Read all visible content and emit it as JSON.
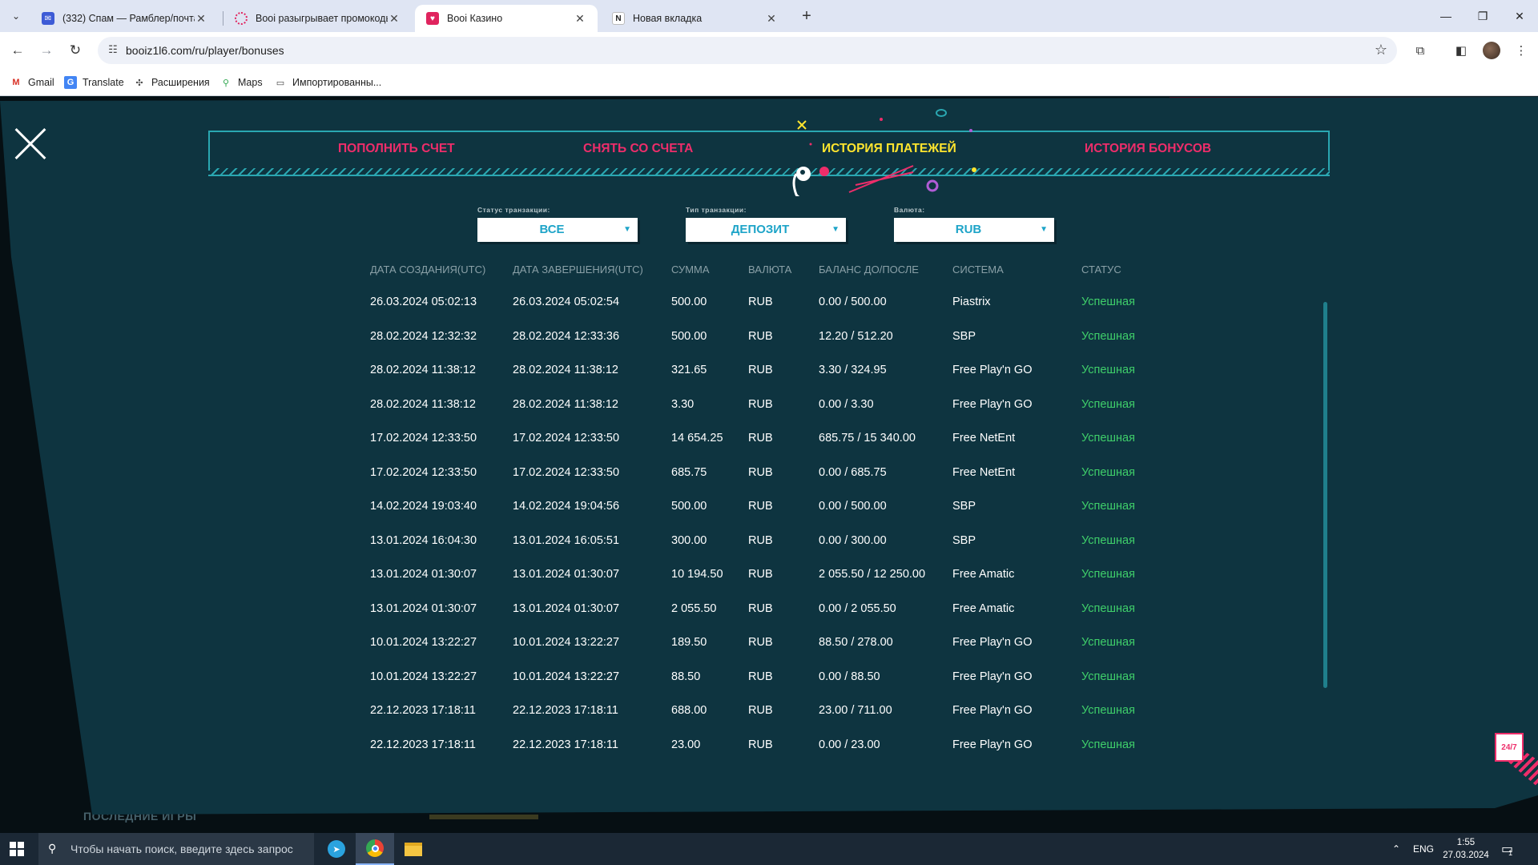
{
  "browser": {
    "tabs": [
      {
        "label": "(332) Спам — Рамблер/почта",
        "close": "✕",
        "active": false
      },
      {
        "label": "Booi разыгрывает промокоды",
        "close": "✕",
        "active": false
      },
      {
        "label": "Booi Казино",
        "close": "✕",
        "active": true
      },
      {
        "label": "Новая вкладка",
        "close": "✕",
        "active": false
      }
    ],
    "new_tab": "+",
    "url": "booiz1l6.com/ru/player/bonuses",
    "bookmarks": [
      "Gmail",
      "Translate",
      "Расширения",
      "Maps",
      "Импортированны..."
    ],
    "colors": {
      "tabbar": "#dfe5f3",
      "toolbar": "#ffffff"
    }
  },
  "modal": {
    "nav": {
      "deposit": "ПОПОЛНИТЬ СЧЕТ",
      "withdraw": "СНЯТЬ СО СЧЕТА",
      "payment_history": "ИСТОРИЯ ПЛАТЕЖЕЙ",
      "bonus_history": "ИСТОРИЯ БОНУСОВ"
    },
    "filters": {
      "status": {
        "label": "Статус транзакции:",
        "value": "ВСЕ"
      },
      "type": {
        "label": "Тип транзакции:",
        "value": "ДЕПОЗИТ"
      },
      "currency": {
        "label": "Валюта:",
        "value": "RUB"
      }
    },
    "table": {
      "headers": [
        "ДАТА СОЗДАНИЯ(UTC)",
        "ДАТА ЗАВЕРШЕНИЯ(UTC)",
        "СУММА",
        "ВАЛЮТА",
        "БАЛАНС ДО/ПОСЛЕ",
        "СИСТЕМА",
        "СТАТУС"
      ],
      "rows": [
        [
          "26.03.2024 05:02:13",
          "26.03.2024 05:02:54",
          "500.00",
          "RUB",
          "0.00 / 500.00",
          "Piastrix",
          "Успешная"
        ],
        [
          "28.02.2024 12:32:32",
          "28.02.2024 12:33:36",
          "500.00",
          "RUB",
          "12.20 / 512.20",
          "SBP",
          "Успешная"
        ],
        [
          "28.02.2024 11:38:12",
          "28.02.2024 11:38:12",
          "321.65",
          "RUB",
          "3.30 / 324.95",
          "Free Play'n GO",
          "Успешная"
        ],
        [
          "28.02.2024 11:38:12",
          "28.02.2024 11:38:12",
          "3.30",
          "RUB",
          "0.00 / 3.30",
          "Free Play'n GO",
          "Успешная"
        ],
        [
          "17.02.2024 12:33:50",
          "17.02.2024 12:33:50",
          "14 654.25",
          "RUB",
          "685.75 / 15 340.00",
          "Free NetEnt",
          "Успешная"
        ],
        [
          "17.02.2024 12:33:50",
          "17.02.2024 12:33:50",
          "685.75",
          "RUB",
          "0.00 / 685.75",
          "Free NetEnt",
          "Успешная"
        ],
        [
          "14.02.2024 19:03:40",
          "14.02.2024 19:04:56",
          "500.00",
          "RUB",
          "0.00 / 500.00",
          "SBP",
          "Успешная"
        ],
        [
          "13.01.2024 16:04:30",
          "13.01.2024 16:05:51",
          "300.00",
          "RUB",
          "0.00 / 300.00",
          "SBP",
          "Успешная"
        ],
        [
          "13.01.2024 01:30:07",
          "13.01.2024 01:30:07",
          "10 194.50",
          "RUB",
          "2 055.50 / 12 250.00",
          "Free Amatic",
          "Успешная"
        ],
        [
          "13.01.2024 01:30:07",
          "13.01.2024 01:30:07",
          "2 055.50",
          "RUB",
          "0.00 / 2 055.50",
          "Free Amatic",
          "Успешная"
        ],
        [
          "10.01.2024 13:22:27",
          "10.01.2024 13:22:27",
          "189.50",
          "RUB",
          "88.50 / 278.00",
          "Free Play'n GO",
          "Успешная"
        ],
        [
          "10.01.2024 13:22:27",
          "10.01.2024 13:22:27",
          "88.50",
          "RUB",
          "0.00 / 88.50",
          "Free Play'n GO",
          "Успешная"
        ],
        [
          "22.12.2023 17:18:11",
          "22.12.2023 17:18:11",
          "688.00",
          "RUB",
          "23.00 / 711.00",
          "Free Play'n GO",
          "Успешная"
        ],
        [
          "22.12.2023 17:18:11",
          "22.12.2023 17:18:11",
          "23.00",
          "RUB",
          "0.00 / 23.00",
          "Free Play'n GO",
          "Успешная"
        ]
      ]
    },
    "support_badge": "24/7",
    "colors": {
      "modal_bg": "#0e3440",
      "accent_pink": "#ee2d6a",
      "accent_yellow": "#ffe52e",
      "accent_cyan": "#2aa7b1",
      "status_success": "#3fcf6a"
    }
  },
  "behind_page": {
    "last_games": "ПОСЛЕДНИЕ ИГРЫ"
  },
  "taskbar": {
    "search_placeholder": "Чтобы начать поиск, введите здесь запрос",
    "language": "ENG",
    "time": "1:55",
    "date": "27.03.2024",
    "notification_count": "1"
  }
}
